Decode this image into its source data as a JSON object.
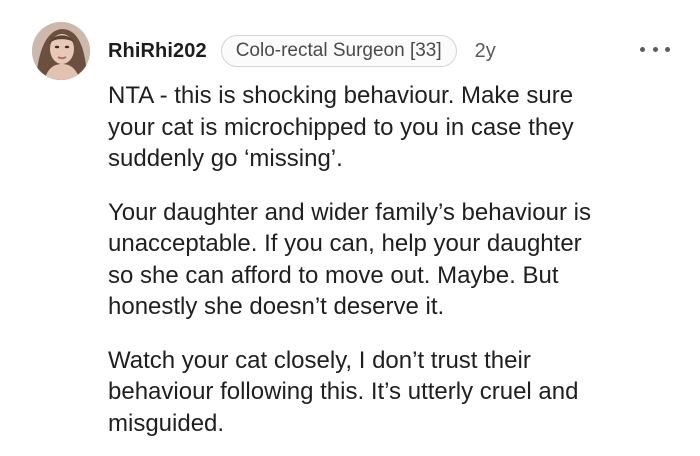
{
  "comment": {
    "username": "RhiRhi202",
    "flair": "Colo-rectal Surgeon [33]",
    "timestamp": "2y",
    "more_icon": "more-horizontal-icon",
    "paragraphs": [
      {
        "lines": [
          "NTA - this is shocking behaviour. Make sure",
          "your cat is microchipped to you in case they",
          "suddenly go ‘missing’."
        ]
      },
      {
        "lines": [
          "Your daughter and wider family’s behaviour is",
          "unacceptable. If you can, help your daughter",
          "so she can afford to move out. Maybe. But",
          "honestly she doesn’t deserve it."
        ]
      },
      {
        "lines": [
          "Watch your cat closely, I don’t trust their",
          "behaviour following this. It’s utterly cruel and",
          "misguided."
        ]
      }
    ]
  }
}
